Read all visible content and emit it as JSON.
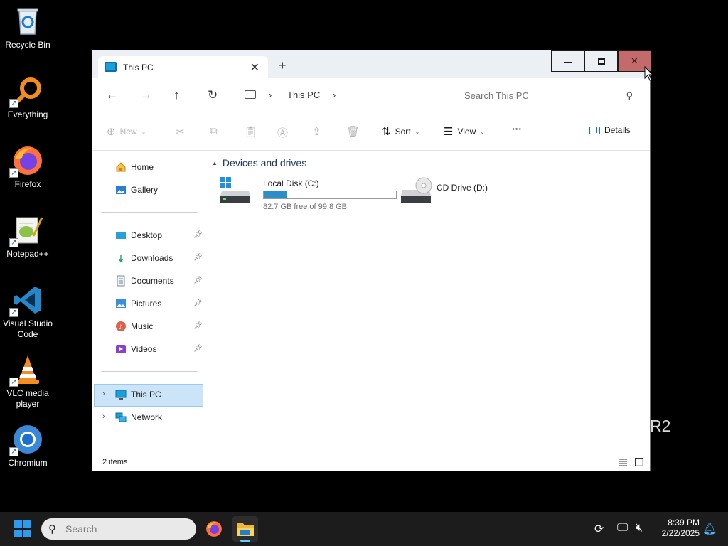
{
  "desktop": {
    "icons": [
      {
        "label": "Recycle Bin",
        "icon": "recycle-bin-icon"
      },
      {
        "label": "Everything",
        "icon": "everything-search-icon"
      },
      {
        "label": "Firefox",
        "icon": "firefox-icon"
      },
      {
        "label": "Notepad++",
        "icon": "notepad-plus-plus-icon"
      },
      {
        "label": "Visual Studio Code",
        "icon": "vscode-icon"
      },
      {
        "label": "VLC media player",
        "icon": "vlc-icon"
      },
      {
        "label": "Chromium",
        "icon": "chromium-icon"
      }
    ],
    "watermark": "R2"
  },
  "window": {
    "tab_title": "This PC",
    "tab_icon": "this-pc-icon",
    "buttons": {
      "minimize": "–",
      "maximize": "☐",
      "close": "✕"
    }
  },
  "address": {
    "breadcrumb": "This PC",
    "search_placeholder": "Search This PC"
  },
  "toolbar": {
    "new_label": "New",
    "sort_label": "Sort",
    "view_label": "View",
    "more_label": "···",
    "details_label": "Details"
  },
  "navpane": {
    "top_items": [
      {
        "label": "Home",
        "icon": "home-icon"
      },
      {
        "label": "Gallery",
        "icon": "gallery-icon"
      }
    ],
    "pinned_items": [
      {
        "label": "Desktop",
        "icon": "desktop-folder-icon"
      },
      {
        "label": "Downloads",
        "icon": "downloads-icon"
      },
      {
        "label": "Documents",
        "icon": "documents-icon"
      },
      {
        "label": "Pictures",
        "icon": "pictures-icon"
      },
      {
        "label": "Music",
        "icon": "music-icon"
      },
      {
        "label": "Videos",
        "icon": "videos-icon"
      }
    ],
    "tree_items": [
      {
        "label": "This PC",
        "icon": "this-pc-icon",
        "selected": true
      },
      {
        "label": "Network",
        "icon": "network-icon",
        "selected": false
      }
    ]
  },
  "content": {
    "group_header": "Devices and drives",
    "drives": [
      {
        "name": "Local Disk (C:)",
        "free_text": "82.7 GB free of 99.8 GB",
        "used_fraction": 0.171,
        "icon": "local-disk-icon"
      },
      {
        "name": "CD Drive (D:)",
        "icon": "cd-drive-icon"
      }
    ]
  },
  "status": {
    "item_count": "2 items"
  },
  "taskbar": {
    "search_placeholder": "Search",
    "clock_time": "8:39 PM",
    "clock_date": "2/22/2025",
    "accent": "#60cdff"
  }
}
